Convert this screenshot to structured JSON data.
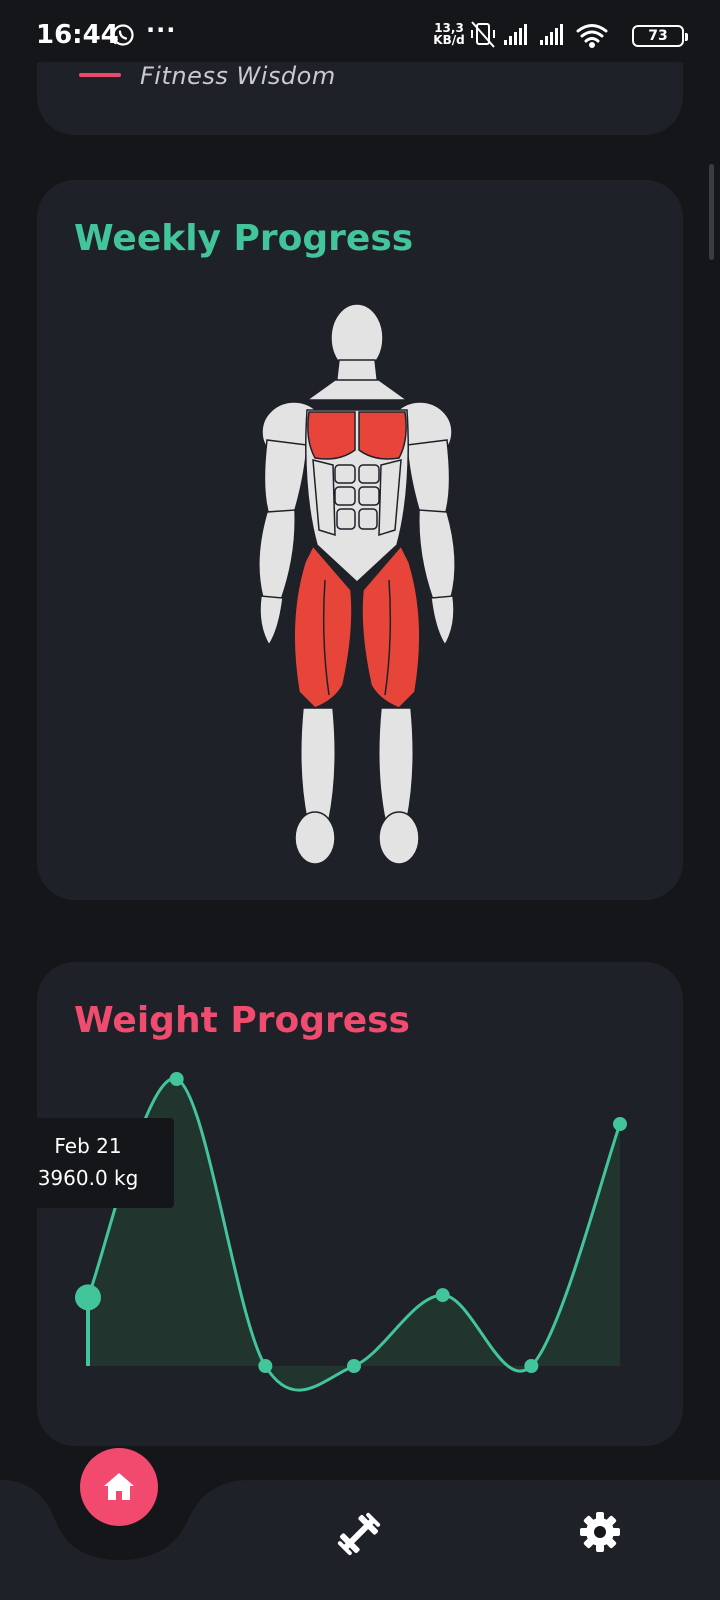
{
  "status_bar": {
    "time": "16:44",
    "more": "···",
    "net_speed_value": "13,3",
    "net_speed_unit": "KB/d",
    "battery": "73"
  },
  "wisdom_card": {
    "label": "Fitness Wisdom"
  },
  "weekly_progress": {
    "title": "Weekly Progress",
    "highlighted_muscles": [
      "chest",
      "quadriceps"
    ],
    "highlight_color": "#e8453a",
    "body_color": "#e3e3e3"
  },
  "weight_progress": {
    "title": "Weight Progress",
    "tooltip": {
      "date": "Feb 21",
      "value": "3960.0 kg"
    }
  },
  "chart_data": {
    "type": "area",
    "title": "Weight Progress",
    "xlabel": "",
    "ylabel": "",
    "points": 7,
    "values": [
      3960,
      5900,
      3350,
      3350,
      3980,
      3350,
      5500
    ],
    "selected_index": 0,
    "line_color": "#43c59b",
    "fill_color": "#22342e",
    "grid": false
  },
  "bottom_nav": {
    "items": [
      {
        "name": "home",
        "icon": "home-icon",
        "active": true
      },
      {
        "name": "workouts",
        "icon": "dumbbell-icon",
        "active": false
      },
      {
        "name": "settings",
        "icon": "gear-icon",
        "active": false
      }
    ],
    "accent": "#f2496e"
  }
}
